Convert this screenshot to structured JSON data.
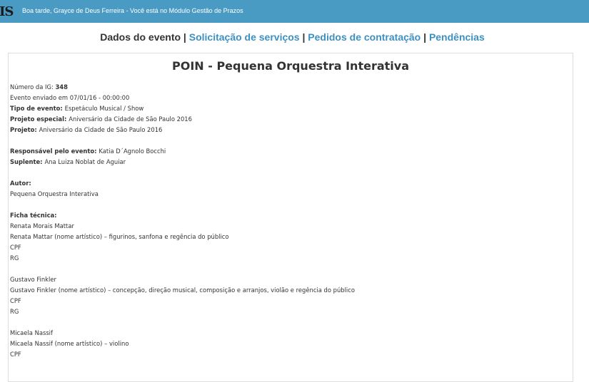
{
  "topbar": {
    "logo": "IS",
    "greeting": "Boa tarde, Grayce de Deus Ferreira - Você está no Módulo Gestão de Prazos"
  },
  "nav": {
    "current": "Dados do evento",
    "sep": "|",
    "links": [
      "Solicitação de serviços",
      "Pedidos de contratação",
      "Pendências"
    ]
  },
  "event": {
    "title": "POIN - Pequena Orquestra Interativa",
    "ig_label": "Número da IG: ",
    "ig_value": "348",
    "sent": "Evento enviado em 07/01/16 - 00:00:00",
    "tipo_label": "Tipo de evento: ",
    "tipo_value": "Espetáculo Musical / Show",
    "projeto_especial_label": "Projeto especial: ",
    "projeto_especial_value": "Aniversário da Cidade de São Paulo 2016",
    "projeto_label": "Projeto: ",
    "projeto_value": "Aniversário da Cidade de São Paulo 2016",
    "responsavel_label": "Responsável pelo evento: ",
    "responsavel_value": "Katia D´Agnolo Bocchi",
    "suplente_label": "Suplente: ",
    "suplente_value": "Ana Luiza Noblat de Aguiar",
    "autor_label": "Autor:",
    "autor_value": "Pequena Orquestra Interativa",
    "ficha_label": "Ficha técnica:",
    "ficha": [
      {
        "name": "Renata Morais Mattar",
        "role": "Renata Mattar (nome artístico) – figurinos, sanfona e regência do público",
        "cpf": "CPF",
        "rg": "RG"
      },
      {
        "name": "Gustavo Finkler",
        "role": "Gustavo Finkler (nome artístico) – concepção, direção musical, composição e arranjos, violão e regência do público",
        "cpf": "CPF",
        "rg": "RG"
      },
      {
        "name": "Micaela Nassif",
        "role": "Micaela Nassif (nome artístico) – violino",
        "cpf": "CPF"
      }
    ]
  }
}
